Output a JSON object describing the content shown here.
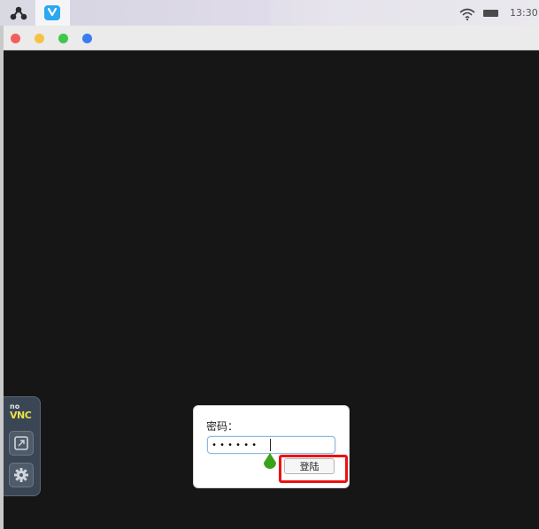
{
  "system_bar": {
    "clock": "13:30",
    "launcher_icon": "launcher-icon",
    "app_icon": "heart-app-icon",
    "wifi_icon": "wifi-icon",
    "battery_icon": "battery-icon"
  },
  "window": {
    "controls": [
      "close",
      "minimize",
      "maximize",
      "extra"
    ],
    "colors": {
      "close": "#f25e5b",
      "minimize": "#f7c243",
      "maximize": "#3fc64b",
      "extra": "#3a7cf1"
    }
  },
  "novnc": {
    "logo_top": "no",
    "logo_bottom": "VNC",
    "buttons": [
      "display-icon",
      "gear-icon"
    ]
  },
  "login_dialog": {
    "password_label": "密码：",
    "password_value": "••••••",
    "login_button": "登陆"
  },
  "colors": {
    "background": "#161616",
    "highlight": "#ee1111",
    "cursor": "#3aa21a"
  }
}
